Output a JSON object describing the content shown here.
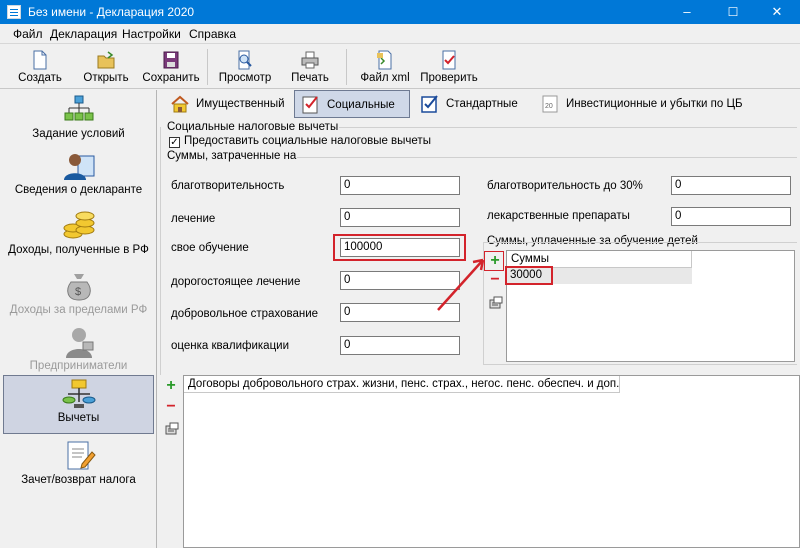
{
  "window": {
    "title": "Без имени - Декларация 2020",
    "minimize": "–",
    "maximize": "☐",
    "close": "✕"
  },
  "menu": [
    "Файл",
    "Декларация",
    "Настройки",
    "Справка"
  ],
  "toolbar": {
    "create": "Создать",
    "open": "Открыть",
    "save": "Сохранить",
    "preview": "Просмотр",
    "print": "Печать",
    "xml": "Файл xml",
    "check": "Проверить"
  },
  "sidebar": {
    "conditions": "Задание условий",
    "declarant": "Сведения о декларанте",
    "income_rf": "Доходы, полученные в РФ",
    "income_abroad": "Доходы за пределами РФ",
    "entrepreneurs": "Предприниматели",
    "deductions": "Вычеты",
    "refund": "Зачет/возврат налога"
  },
  "tabs": {
    "property": "Имущественный",
    "social": "Социальные",
    "standard": "Стандартные",
    "investment": "Инвестиционные и убытки по ЦБ"
  },
  "social": {
    "group_title": "Социальные налоговые вычеты",
    "checkbox_label": "Предоставить социальные налоговые вычеты",
    "checkbox_mark": "✓",
    "sums_title": "Суммы, затраченные на",
    "fields_left": [
      {
        "label": "благотворительность",
        "value": "0"
      },
      {
        "label": "лечение",
        "value": "0"
      },
      {
        "label": "свое обучение",
        "value": "100000"
      },
      {
        "label": "дорогостоящее лечение",
        "value": "0"
      },
      {
        "label": "добровольное страхование",
        "value": "0"
      },
      {
        "label": "оценка квалификации",
        "value": "0"
      }
    ],
    "fields_right": [
      {
        "label": "благотворительность до 30%",
        "value": "0"
      },
      {
        "label": "лекарственные препараты",
        "value": "0"
      }
    ],
    "children_title": "Суммы, уплаченные за обучение детей",
    "children_column": "Суммы",
    "children_rows": [
      "30000"
    ]
  },
  "contracts": {
    "column": "Договоры добровольного страх. жизни, пенс. страх., негос. пенс. обеспеч. и доп..."
  },
  "icons": {
    "add": "+",
    "remove": "−"
  },
  "colors": {
    "accent": "#0078d7",
    "highlight": "#d3232b",
    "add": "#2a9a2a"
  }
}
